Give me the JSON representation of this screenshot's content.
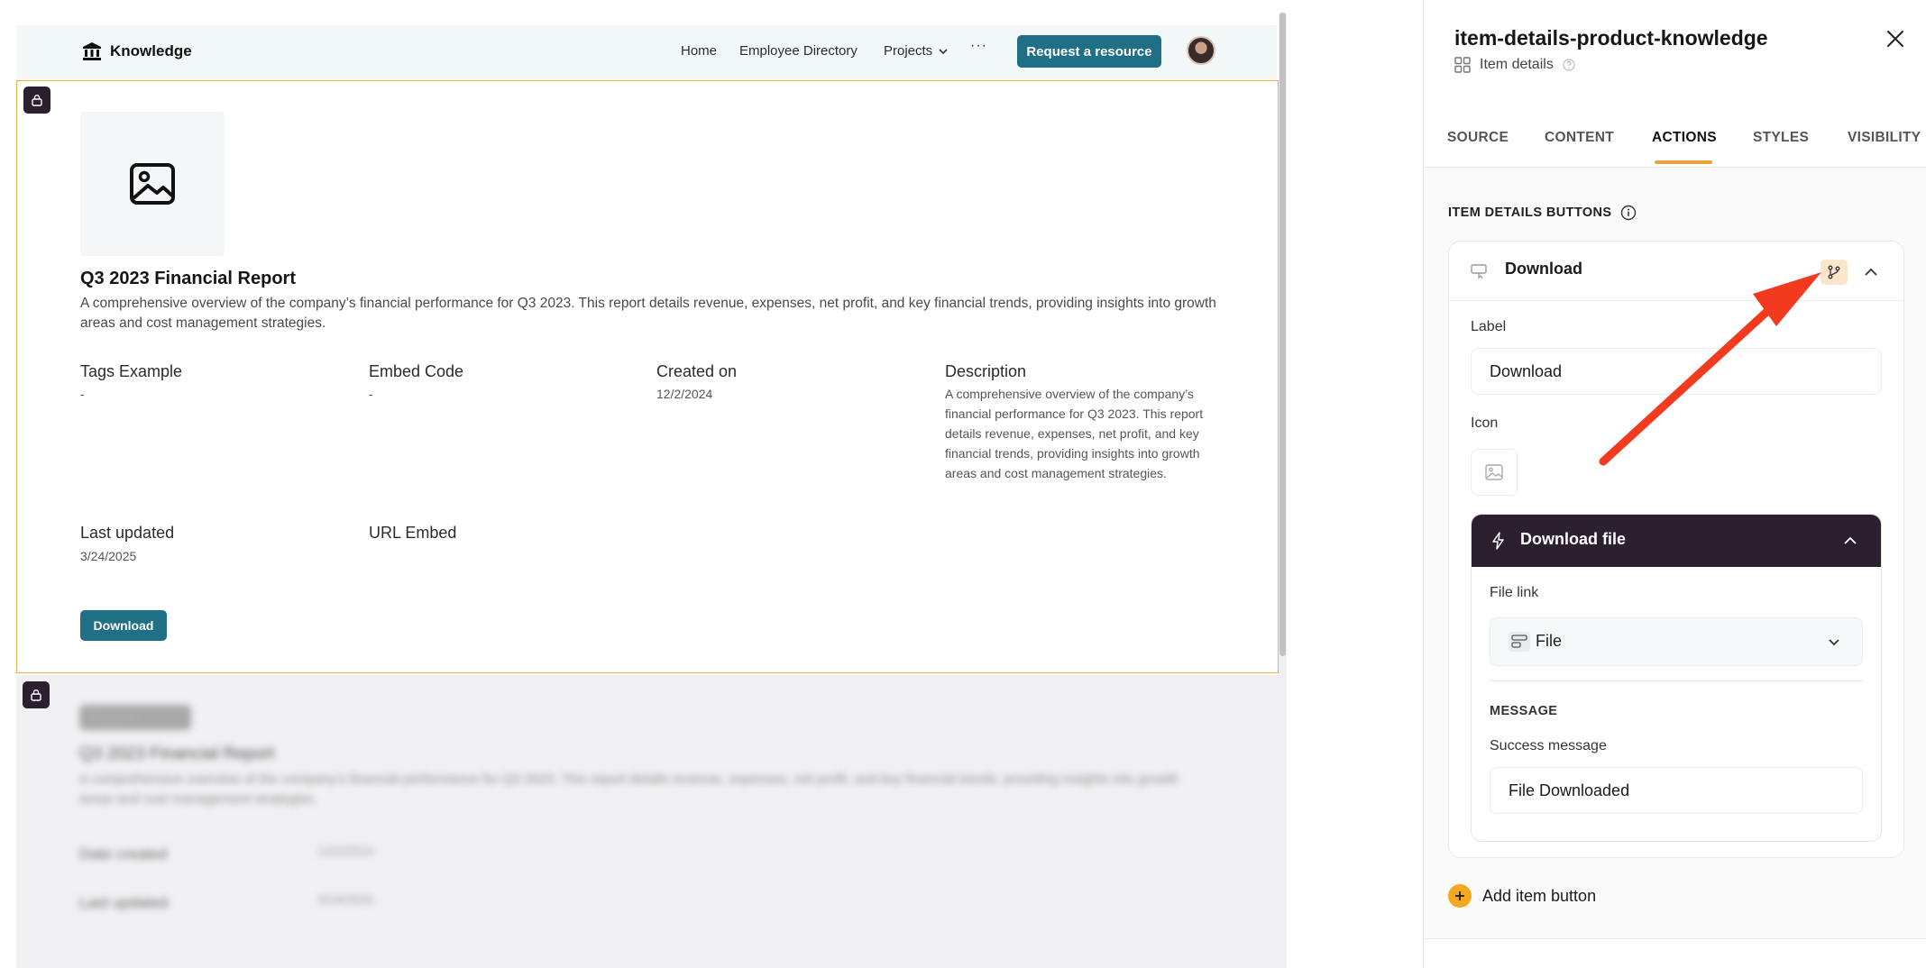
{
  "site": {
    "logo_text": "Knowledge",
    "nav": {
      "home": "Home",
      "directory": "Employee Directory",
      "projects": "Projects",
      "more": "···",
      "request": "Request a resource"
    }
  },
  "item": {
    "title": "Q3 2023 Financial Report",
    "description": "A comprehensive overview of the company’s financial performance for Q3 2023. This report details revenue, expenses, net profit, and key financial trends, providing insights into growth areas and cost management strategies.",
    "fields": {
      "tags_label": "Tags Example",
      "tags_value": "-",
      "embed_label": "Embed Code",
      "embed_value": "-",
      "created_label": "Created on",
      "created_value": "12/2/2024",
      "desc_label": "Description",
      "desc_value": "A comprehensive overview of the company’s financial performance for Q3 2023. This report details revenue, expenses, net profit, and key financial trends, providing insights into growth areas and cost management strategies.",
      "updated_label": "Last updated",
      "updated_value": "3/24/2025",
      "url_label": "URL Embed"
    },
    "download_button": "Download"
  },
  "blurred": {
    "badge": "Featured",
    "title": "Q3 2023 Financial Report",
    "description": "A comprehensive overview of the company's financial performance for Q3 2023. This report details revenue, expenses, net profit, and key financial trends, providing insights into growth areas and cost management strategies.",
    "row1_label": "Date created",
    "row1_value": "12/2/2024",
    "row2_label": "Last updated",
    "row2_value": "3/24/2025"
  },
  "panel": {
    "title": "item-details-product-knowledge",
    "subtitle": "Item details",
    "tabs": [
      "SOURCE",
      "CONTENT",
      "ACTIONS",
      "STYLES",
      "VISIBILITY"
    ],
    "active_tab": "ACTIONS",
    "section_heading": "ITEM DETAILS BUTTONS",
    "button_card": {
      "title": "Download",
      "label_label": "Label",
      "label_value": "Download",
      "icon_label": "Icon",
      "action": {
        "title": "Download file",
        "file_link_label": "File link",
        "file_link_value": "File",
        "message_heading": "MESSAGE",
        "success_label": "Success message",
        "success_value": "File Downloaded"
      }
    },
    "add_button": "Add item button"
  },
  "colors": {
    "primary": "#1f6f86",
    "accent": "#f3a91f",
    "dark": "#2b1f30",
    "selection": "#f0b343",
    "annotation_arrow": "#f23a1f"
  }
}
